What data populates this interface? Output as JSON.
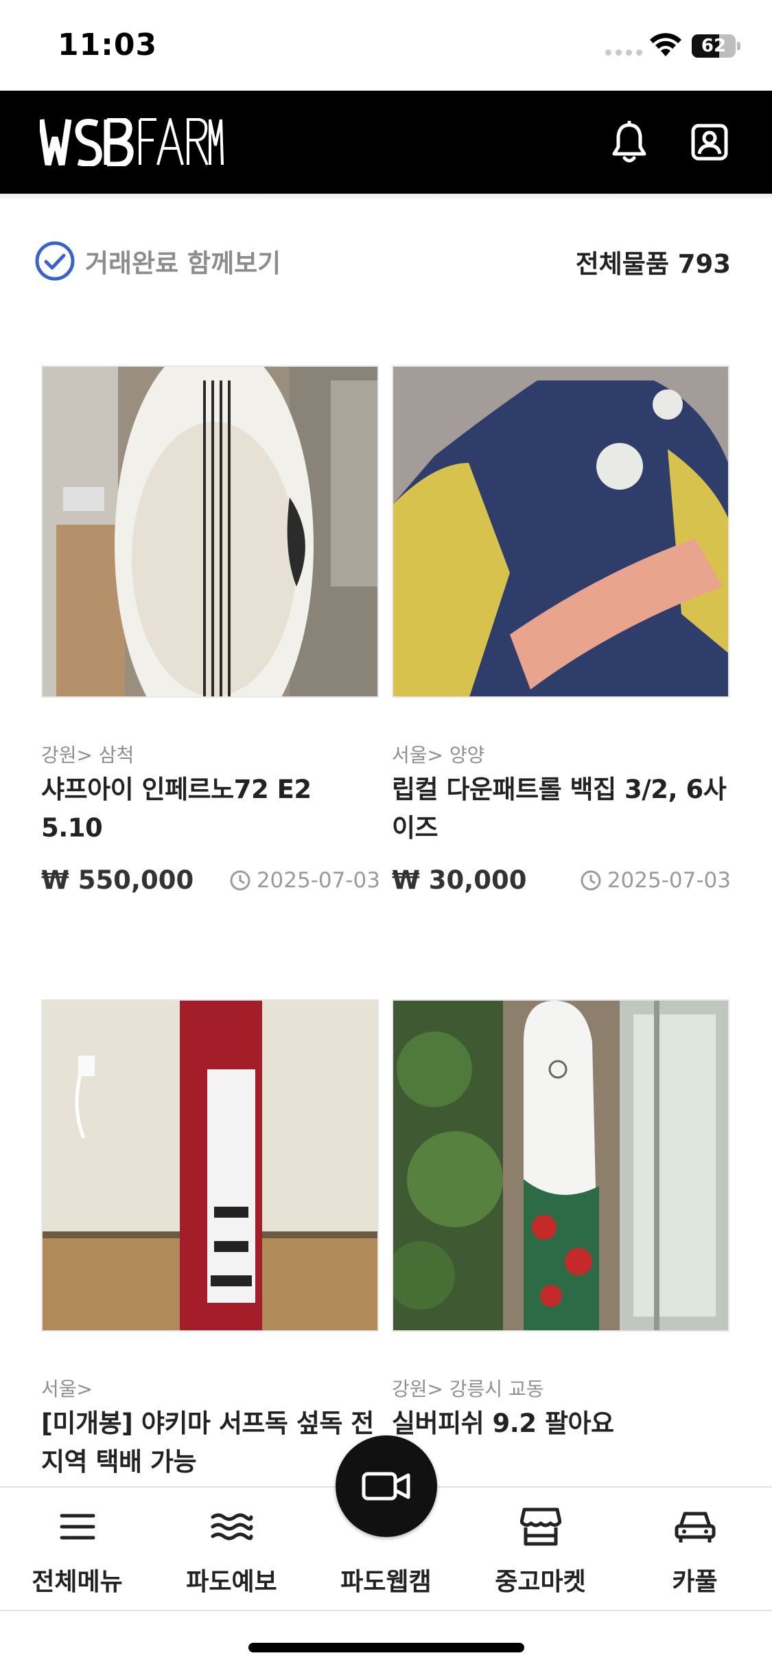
{
  "status_bar": {
    "time": "11:03",
    "battery": "62",
    "battery_level": 0.62
  },
  "header": {
    "logo": "WSBFARM"
  },
  "filter": {
    "completed_label": "거래완료 함께보기",
    "total_label": "전체물품 793"
  },
  "products": [
    {
      "location": "강원> 삼척",
      "title": "샤프아이 인페르노72 E2 5.10",
      "price": "₩ 550,000",
      "date": "2025-07-03"
    },
    {
      "location": "서울> 양양",
      "title": "립컬 다운패트롤 백집 3/2, 6사이즈",
      "price": "₩ 30,000",
      "date": "2025-07-03"
    },
    {
      "location": "서울>",
      "title": "[미개봉] 야키마 서프독 섶독 전지역 택배 가능",
      "price": "",
      "date": ""
    },
    {
      "location": "강원> 강릉시 교동",
      "title": "실버피쉬 9.2 팔아요",
      "price": "",
      "date": ""
    }
  ],
  "nav": {
    "items": [
      {
        "label": "전체메뉴",
        "icon": "menu-icon"
      },
      {
        "label": "파도예보",
        "icon": "waves-icon"
      },
      {
        "label": "파도웹캠",
        "icon": "video-camera-icon"
      },
      {
        "label": "중고마켓",
        "icon": "store-icon"
      },
      {
        "label": "카풀",
        "icon": "car-icon"
      }
    ]
  },
  "colors": {
    "accent": "#3b63c7",
    "header_bg": "#000000",
    "muted": "#8c8c8c"
  }
}
